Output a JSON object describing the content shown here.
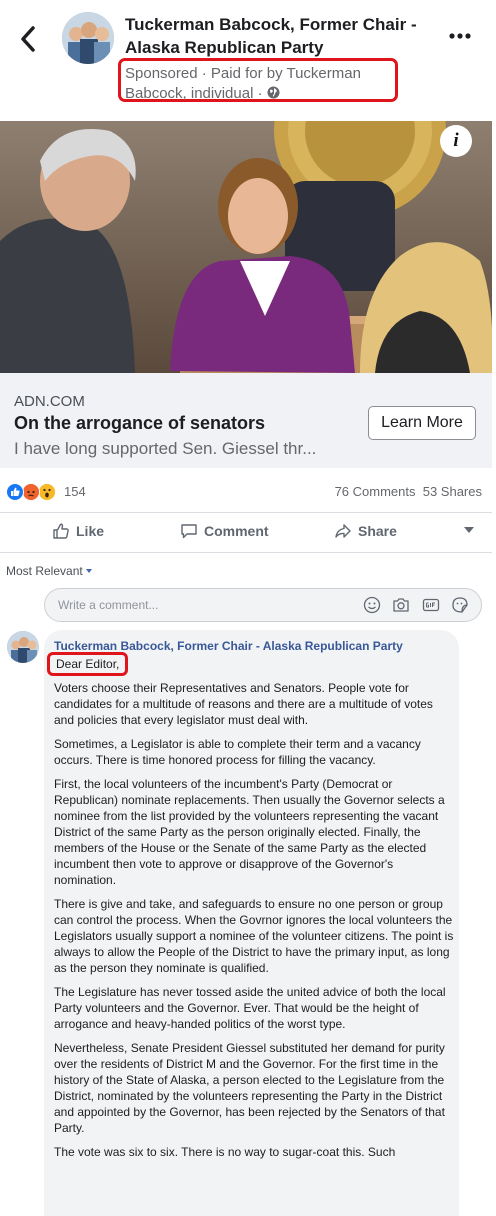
{
  "header": {
    "page_name": "Tuckerman Babcock, Former Chair - Alaska Republican Party",
    "sponsored_line": "Sponsored · Paid for by Tuckerman Babcock, individual ·",
    "more_icon": "more-horizontal-icon",
    "back_icon": "back-arrow-icon"
  },
  "ad": {
    "domain": "ADN.COM",
    "headline": "On the arrogance of senators",
    "description": "I have long supported Sen. Giessel thr...",
    "cta": "Learn More",
    "info_label": "i"
  },
  "stats": {
    "reaction_count": "154",
    "comments": "76 Comments",
    "shares": "53 Shares",
    "reaction_icons": [
      "like-reaction-icon",
      "angry-reaction-icon",
      "wow-reaction-icon"
    ]
  },
  "actions": {
    "like": "Like",
    "comment": "Comment",
    "share": "Share"
  },
  "comments": {
    "sort_label": "Most Relevant",
    "placeholder": "Write a comment...",
    "items": [
      {
        "author": "Tuckerman Babcock, Former Chair - Alaska Republican Party",
        "greeting": "Dear Editor,",
        "paragraphs": [
          "Voters choose their Representatives and Senators. People vote for candidates for a multitude of reasons and there are a multitude of votes and policies that every legislator must deal with.",
          "Sometimes, a Legislator is able to complete their term and a vacancy occurs. There is time honored process for filling the vacancy.",
          "First, the local volunteers of the incumbent's Party (Democrat or Republican) nominate replacements. Then usually the Governor selects a nominee from the list provided by the volunteers representing the vacant District of the same Party as the person originally elected. Finally, the members of the House or the Senate of the same Party as the elected incumbent then vote to approve or disapprove of the Governor's nomination.",
          "There is give and take, and safeguards to ensure no one person or group can control the process. When the Govrnor ignores the local volunteers the Legislators usually support a nominee of the volunteer citizens. The point is always to allow the People of the District to have the primary input, as long as the person they nominate is qualified.",
          "The Legislature has never tossed aside the united advice of both the local Party volunteers and the Governor. Ever. That would be the height of arrogance and heavy-handed politics of the worst type.",
          "Nevertheless, Senate President Giessel substituted her demand for purity over the residents of District M and the Governor. For the first time in the history of the State of Alaska, a person elected to the Legislature from the District, nominated by the volunteers representing the Party in the District and appointed by the Governor, has been rejected by the Senators of that Party.",
          "The vote was six to six. There is no way to sugar-coat this. Such"
        ]
      }
    ]
  },
  "colors": {
    "highlight": "#e0141b",
    "link": "#385898",
    "muted": "#65676b"
  }
}
